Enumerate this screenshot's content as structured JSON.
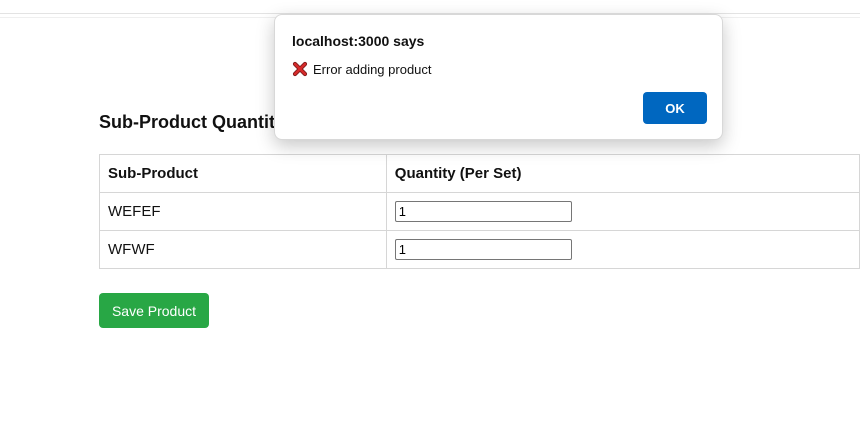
{
  "page": {
    "heading": "Sub-Product Quantities"
  },
  "table": {
    "headers": [
      "Sub-Product",
      "Quantity (Per Set)"
    ],
    "rows": [
      {
        "name": "WEFEF",
        "quantity": "1"
      },
      {
        "name": "WFWF",
        "quantity": "1"
      }
    ]
  },
  "save_button": {
    "label": "Save Product",
    "color": "#28a745"
  },
  "dialog": {
    "title": "localhost:3000 says",
    "icon": "cross-mark-icon",
    "message": "Error adding product",
    "ok_label": "OK",
    "ok_color": "#0067c0"
  }
}
